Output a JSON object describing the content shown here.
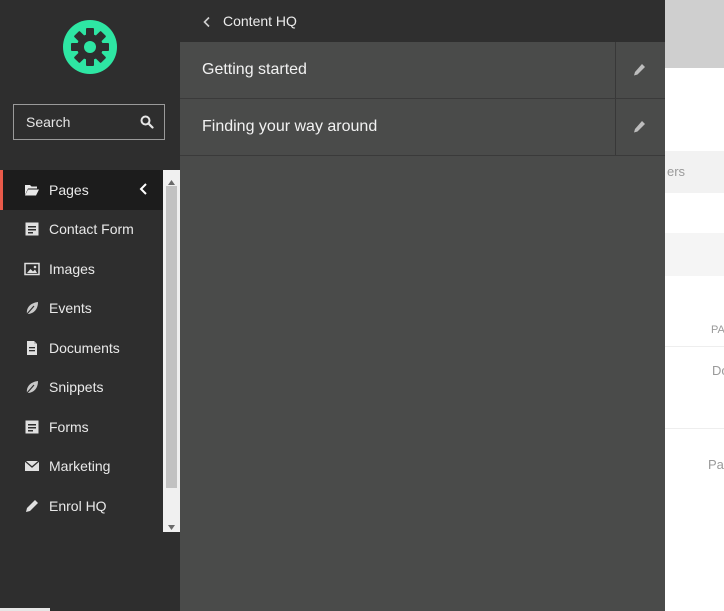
{
  "sidebar": {
    "search_label": "Search",
    "items": [
      {
        "label": "Pages",
        "icon": "folder-open-icon",
        "active": true
      },
      {
        "label": "Contact Form",
        "icon": "form-icon"
      },
      {
        "label": "Images",
        "icon": "image-icon"
      },
      {
        "label": "Events",
        "icon": "leaf-icon"
      },
      {
        "label": "Documents",
        "icon": "document-icon"
      },
      {
        "label": "Snippets",
        "icon": "leaf-icon"
      },
      {
        "label": "Forms",
        "icon": "form-icon"
      },
      {
        "label": "Marketing",
        "icon": "envelope-icon"
      },
      {
        "label": "Enrol HQ",
        "icon": "pencil-icon"
      }
    ]
  },
  "panel": {
    "title": "Content HQ",
    "rows": [
      {
        "label": "Getting started"
      },
      {
        "label": "Finding your way around"
      }
    ]
  },
  "background": {
    "fragments": [
      "ers",
      "PA",
      "Do",
      "Pag"
    ]
  },
  "colors": {
    "logo": "#2ee6a3",
    "active_accent": "#e85a4a",
    "sidebar_bg": "#2e2e2e",
    "panel_bg": "#4a4b4a"
  }
}
